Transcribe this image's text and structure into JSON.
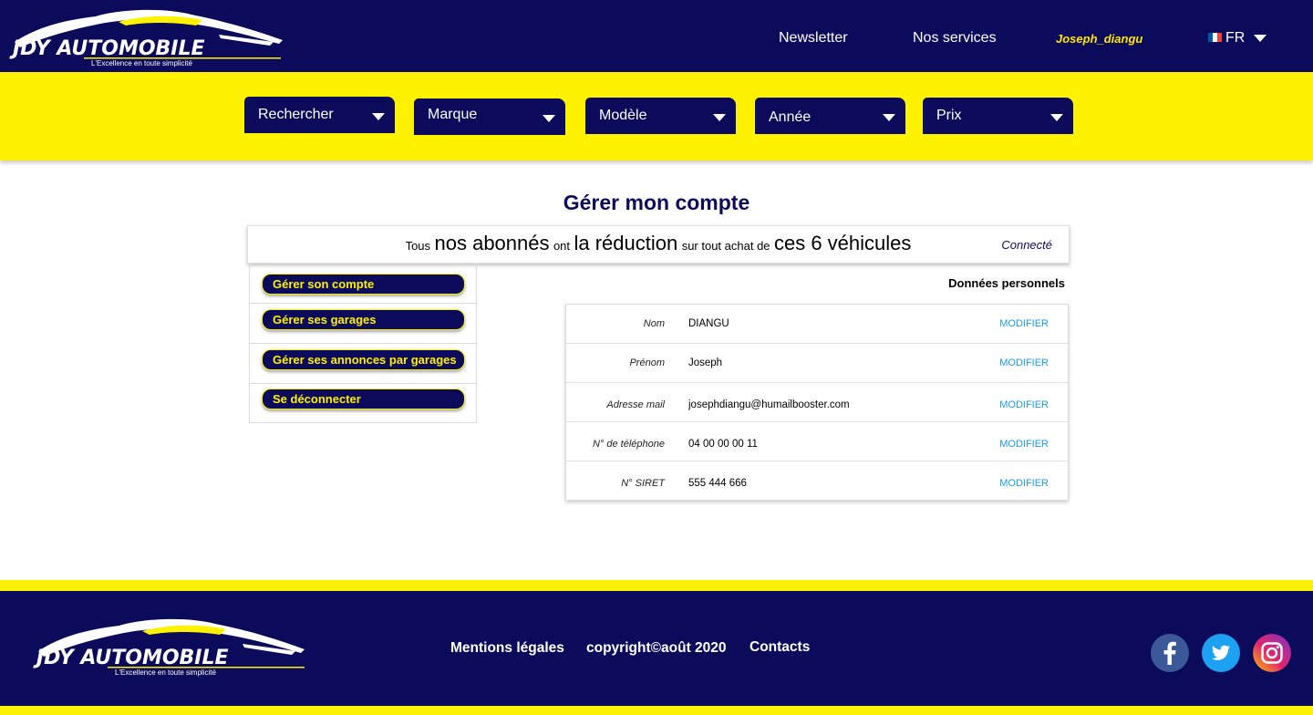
{
  "brand": {
    "name": "JDY AUTOMOBILE",
    "tagline": "L'Excellence en toute simplicité"
  },
  "nav": {
    "newsletter": "Newsletter",
    "services": "Nos services",
    "user": "Joseph_diangu",
    "lang": "FR"
  },
  "filters": [
    "Rechercher",
    "Marque",
    "Modèle",
    "Année",
    "Prix"
  ],
  "page": {
    "title": "Gérer mon compte"
  },
  "promo": {
    "p1": "Tous",
    "p2": "nos abonnés",
    "p3": "ont",
    "p4": "la réduction",
    "p5": "sur tout achat de",
    "p6": "ces 6 véhicules",
    "status": "Connecté"
  },
  "menu": [
    "Gérer son compte",
    "Gérer ses garages",
    "Gérer ses annonces par garages",
    "Se déconnecter"
  ],
  "personal": {
    "heading": "Données personnels",
    "modify_label": "MODIFIER",
    "rows": [
      {
        "label": "Nom",
        "value": "DIANGU"
      },
      {
        "label": "Prénom",
        "value": "Joseph"
      },
      {
        "label": "Adresse mail",
        "value": "josephdiangu@humailbooster.com"
      },
      {
        "label": "N° de téléphone",
        "value": "04 00 00 00 11"
      },
      {
        "label": "N° SIRET",
        "value": "555 444 666"
      }
    ]
  },
  "footer": {
    "legal": "Mentions légales",
    "copyright": "copyright©août 2020",
    "contacts": "Contacts"
  },
  "colors": {
    "navy": "#0c0b5b",
    "yellow": "#fff200",
    "link_blue": "#1a9be6"
  }
}
